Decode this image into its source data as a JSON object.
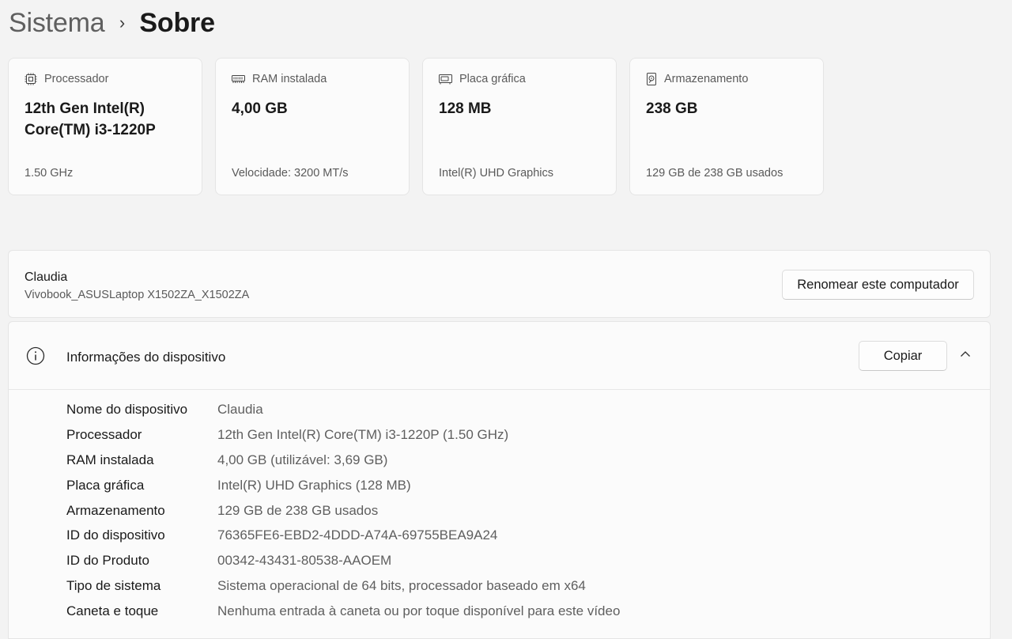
{
  "breadcrumb": {
    "parent": "Sistema",
    "separator": "›",
    "current": "Sobre"
  },
  "cards": [
    {
      "label": "Processador",
      "icon": "processor-icon",
      "value": "12th Gen Intel(R) Core(TM) i3-1220P",
      "sub": "1.50 GHz"
    },
    {
      "label": "RAM instalada",
      "icon": "ram-icon",
      "value": "4,00 GB",
      "sub": "Velocidade: 3200 MT/s"
    },
    {
      "label": "Placa gráfica",
      "icon": "graphics-card-icon",
      "value": "128 MB",
      "sub": "Intel(R) UHD Graphics"
    },
    {
      "label": "Armazenamento",
      "icon": "storage-icon",
      "value": "238 GB",
      "sub": "129 GB de 238 GB usados"
    }
  ],
  "computer": {
    "name": "Claudia",
    "model": "Vivobook_ASUSLaptop X1502ZA_X1502ZA",
    "rename_label": "Renomear este computador"
  },
  "device_info": {
    "title": "Informações do dispositivo",
    "icon": "info-icon",
    "copy_label": "Copiar",
    "expanded": true,
    "rows": [
      {
        "label": "Nome do dispositivo",
        "value": "Claudia"
      },
      {
        "label": "Processador",
        "value": "12th Gen Intel(R) Core(TM) i3-1220P (1.50 GHz)"
      },
      {
        "label": "RAM instalada",
        "value": "4,00 GB (utilizável: 3,69 GB)"
      },
      {
        "label": "Placa gráfica",
        "value": "Intel(R) UHD Graphics (128 MB)"
      },
      {
        "label": "Armazenamento",
        "value": "129 GB de 238 GB usados"
      },
      {
        "label": "ID do dispositivo",
        "value": "76365FE6-EBD2-4DDD-A74A-69755BEA9A24"
      },
      {
        "label": "ID do Produto",
        "value": "00342-43431-80538-AAOEM"
      },
      {
        "label": "Tipo de sistema",
        "value": "Sistema operacional de 64 bits, processador baseado em x64"
      },
      {
        "label": "Caneta e toque",
        "value": "Nenhuma entrada à caneta ou por toque disponível para este vídeo"
      }
    ]
  }
}
